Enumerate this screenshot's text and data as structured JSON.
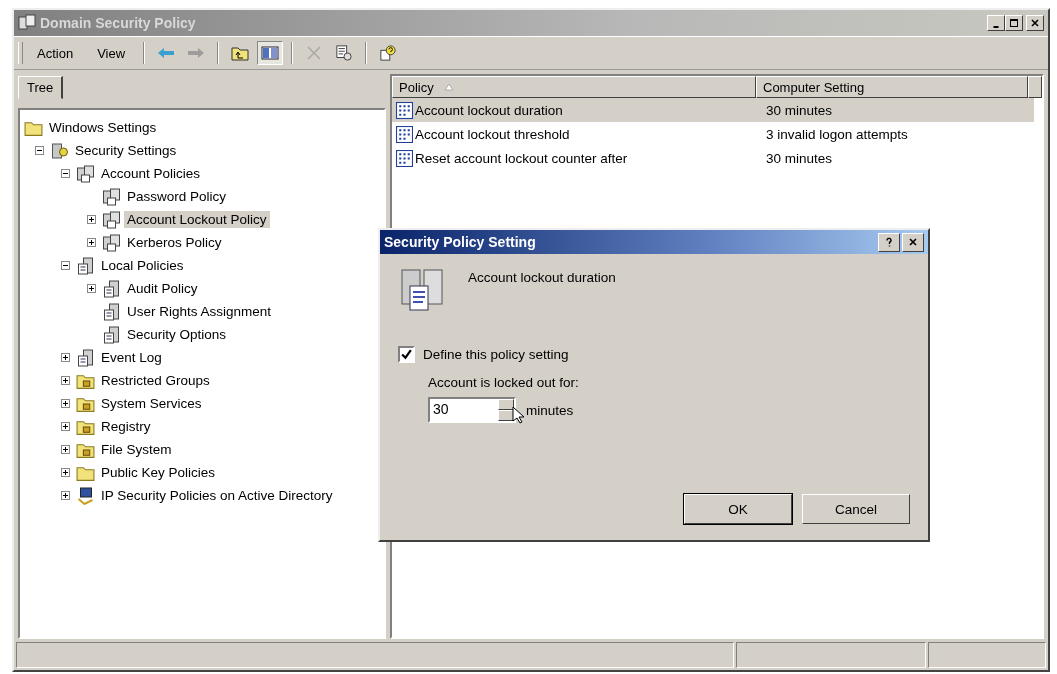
{
  "window": {
    "title": "Domain Security Policy"
  },
  "menu": [
    {
      "label": "Action"
    },
    {
      "label": "View"
    }
  ],
  "toolbar": [
    {
      "kind": "back",
      "disabled": false,
      "pressed": false
    },
    {
      "kind": "forward",
      "disabled": true,
      "pressed": false
    },
    {
      "kind": "up",
      "disabled": false,
      "pressed": false
    },
    {
      "kind": "tree",
      "disabled": false,
      "pressed": true
    },
    {
      "kind": "delete",
      "disabled": true,
      "pressed": false
    },
    {
      "kind": "export",
      "disabled": false,
      "pressed": false
    },
    {
      "kind": "help",
      "disabled": false,
      "pressed": false
    }
  ],
  "tabs": [
    {
      "label": "Tree",
      "selected": true
    }
  ],
  "tree": [
    {
      "label": "Windows Settings",
      "kind": "folder",
      "selected": false,
      "children": [
        {
          "label": "Security Settings",
          "kind": "security",
          "expanded": true,
          "selected": false,
          "children": [
            {
              "label": "Account Policies",
              "kind": "policy",
              "expanded": true,
              "selected": false,
              "children": [
                {
                  "label": "Password Policy",
                  "kind": "policy",
                  "selected": false
                },
                {
                  "label": "Account Lockout Policy",
                  "kind": "policy",
                  "expanded": false,
                  "selected": true
                },
                {
                  "label": "Kerberos Policy",
                  "kind": "policy",
                  "expanded": false,
                  "selected": false
                }
              ]
            },
            {
              "label": "Local Policies",
              "kind": "local",
              "expanded": true,
              "selected": false,
              "children": [
                {
                  "label": "Audit Policy",
                  "kind": "local",
                  "expanded": false,
                  "selected": false
                },
                {
                  "label": "User Rights Assignment",
                  "kind": "local",
                  "selected": false
                },
                {
                  "label": "Security Options",
                  "kind": "local",
                  "selected": false
                }
              ]
            },
            {
              "label": "Event Log",
              "kind": "local",
              "expanded": false,
              "selected": false
            },
            {
              "label": "Restricted Groups",
              "kind": "lockfolder",
              "expanded": false,
              "selected": false
            },
            {
              "label": "System Services",
              "kind": "lockfolder",
              "expanded": false,
              "selected": false
            },
            {
              "label": "Registry",
              "kind": "lockfolder",
              "expanded": false,
              "selected": false
            },
            {
              "label": "File System",
              "kind": "lockfolder",
              "expanded": false,
              "selected": false
            },
            {
              "label": "Public Key Policies",
              "kind": "folder",
              "expanded": false,
              "selected": false
            },
            {
              "label": "IP Security Policies on Active Directory",
              "kind": "network",
              "expanded": false,
              "selected": false
            }
          ]
        }
      ]
    }
  ],
  "list": {
    "columns": [
      "Policy",
      "Computer Setting"
    ],
    "rows": [
      {
        "policy": "Account lockout duration",
        "setting": "30 minutes",
        "selected": true
      },
      {
        "policy": "Account lockout threshold",
        "setting": "3 invalid logon attempts",
        "selected": false
      },
      {
        "policy": "Reset account lockout counter after",
        "setting": "30 minutes",
        "selected": false
      }
    ]
  },
  "dialog": {
    "title": "Security Policy Setting",
    "policy": "Account lockout duration",
    "checkbox": {
      "label": "Define this policy setting",
      "checked": true
    },
    "field_label": "Account is locked out for:",
    "value": "30",
    "unit": "minutes",
    "buttons": [
      "OK",
      "Cancel"
    ]
  }
}
